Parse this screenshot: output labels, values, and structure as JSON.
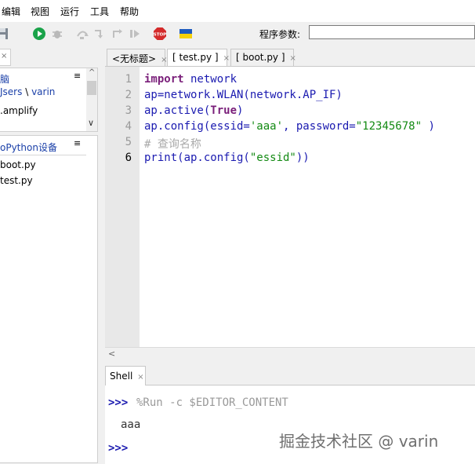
{
  "menu": [
    "编辑",
    "视图",
    "运行",
    "工具",
    "帮助"
  ],
  "toolbar": {
    "icons": [
      "folder-icon",
      "save-icon",
      "run-icon",
      "debug-icon",
      "step-over-icon",
      "step-into-icon",
      "step-out-icon",
      "resume-icon",
      "stop-icon",
      "flag-icon"
    ],
    "stop_label": "STOP",
    "args_label": "程序参数:",
    "args_value": ""
  },
  "colors": {
    "accent": "#1a3fa8",
    "stop": "#d42a2a",
    "run": "#1aa34a",
    "flag_blue": "#1d5bbf",
    "flag_yellow": "#f5d10a"
  },
  "files_pane": {
    "title": "脑",
    "path_prefix": "Jsers",
    "path_separator": "\\",
    "path_user": "varin",
    "items": [
      ".amplify"
    ]
  },
  "device_pane": {
    "title": "oPython设备",
    "items": [
      "boot.py",
      "test.py"
    ]
  },
  "editor_tabs": [
    {
      "label": "<无标题>"
    },
    {
      "label": "[ test.py ]"
    },
    {
      "label": "[ boot.py ]"
    }
  ],
  "editor": {
    "line_numbers": [
      "1",
      "2",
      "3",
      "4",
      "5",
      "6"
    ],
    "code": {
      "l1_kw": "import",
      "l1_rest": " network",
      "l2": "ap=network.WLAN(network.AP_IF)",
      "l3_pre": "ap.active(",
      "l3_kw": "True",
      "l3_post": ")",
      "l4_pre": "ap.config(essid=",
      "l4_s1": "'aaa'",
      "l4_mid": ", password=",
      "l4_s2": "\"12345678\"",
      "l4_post": " )",
      "l5": "# 查询名称",
      "l6_pre": "print(ap.config(",
      "l6_s": "\"essid\"",
      "l6_post": "))"
    }
  },
  "shell": {
    "tab_label": "Shell",
    "prompt": ">>>",
    "command": "%Run -c $EDITOR_CONTENT",
    "output": "aaa"
  },
  "watermark": "掘金技术社区 @ varin"
}
